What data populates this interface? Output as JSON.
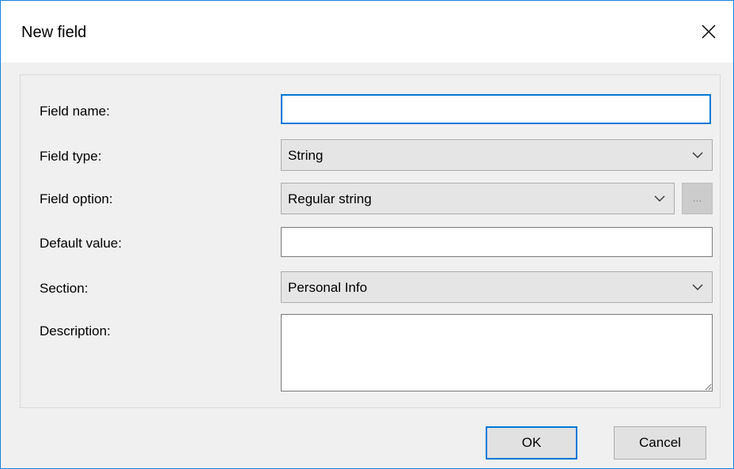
{
  "window": {
    "title": "New field"
  },
  "form": {
    "field_name": {
      "label": "Field name:",
      "value": ""
    },
    "field_type": {
      "label": "Field type:",
      "selected": "String"
    },
    "field_option": {
      "label": "Field option:",
      "selected": "Regular string",
      "browse_label": "..."
    },
    "default_value": {
      "label": "Default value:",
      "value": ""
    },
    "section": {
      "label": "Section:",
      "selected": "Personal Info"
    },
    "description": {
      "label": "Description:",
      "value": ""
    }
  },
  "buttons": {
    "ok_label": "OK",
    "cancel_label": "Cancel"
  },
  "icons": {
    "close": "close-icon",
    "dropdown": "chevron-down-icon"
  },
  "colors": {
    "accent": "#0078d7",
    "window_border": "#1883d7",
    "dialog_background": "#f0f0f0"
  }
}
